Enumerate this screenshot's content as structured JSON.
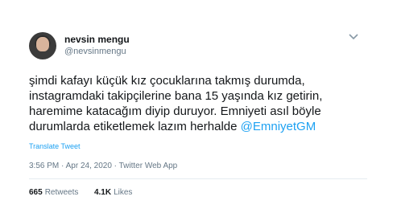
{
  "author": {
    "display_name": "nevsin mengu",
    "handle": "@nevsinmengu",
    "avatar_icon": "profile-avatar"
  },
  "tweet": {
    "text_lines": [
      "şimdi kafayı küçük kız çocuklarına takmış durumda,",
      "instagramdaki takipçilerine bana 15 yaşında kız getirin,",
      "haremime katacağım diyip duruyor. Emniyeti asıl böyle",
      "durumlarda etiketlemek lazım herhalde "
    ],
    "mention": "@EmniyetGM",
    "translate_label": "Translate Tweet",
    "time": "3:56 PM",
    "separator": "·",
    "date": "Apr 24, 2020",
    "source": "Twitter Web App"
  },
  "stats": {
    "retweets_count": "665",
    "retweets_label": "Retweets",
    "likes_count": "4.1K",
    "likes_label": "Likes"
  },
  "colors": {
    "link": "#1da1f2",
    "text": "#14171a",
    "muted": "#657786"
  }
}
